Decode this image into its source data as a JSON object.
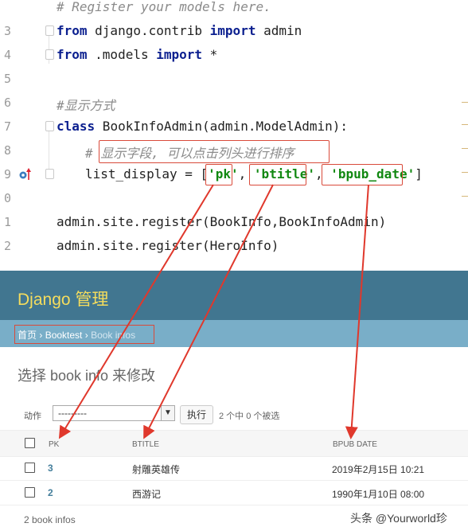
{
  "editor": {
    "lines": [
      {
        "num": "",
        "text": "# Register your models here."
      },
      {
        "num": "3",
        "text": ""
      },
      {
        "num": "4",
        "text": ""
      },
      {
        "num": "5",
        "text": ""
      },
      {
        "num": "6",
        "text": "#显示方式"
      },
      {
        "num": "7",
        "text": ""
      },
      {
        "num": "8",
        "text": "# 显示字段, 可以点击列头进行排序"
      },
      {
        "num": "9",
        "text": ""
      },
      {
        "num": "0",
        "text": ""
      },
      {
        "num": "1",
        "text": "admin.site.register(BookInfo,BookInfoAdmin)"
      },
      {
        "num": "2",
        "text": "admin.site.register(HeroInfo)"
      }
    ],
    "line3": {
      "kw1": "from",
      "mid": " django.contrib ",
      "kw2": "import",
      "tail": " admin"
    },
    "line4": {
      "kw1": "from",
      "mid": " .models ",
      "kw2": "import",
      "tail": " *"
    },
    "line7": {
      "kw": "class",
      "tail": " BookInfoAdmin(admin.ModelAdmin):"
    },
    "line9": {
      "pre": "list_display = [",
      "s1": "'pk'",
      "c1": ", ",
      "s2": "'btitle'",
      "c2": ", ",
      "s3": "'bpub_date'",
      "post": "]"
    }
  },
  "admin": {
    "site_title": "Django 管理",
    "breadcrumbs": {
      "home": "首页",
      "sep": " › ",
      "app": "Booktest",
      "current": "Book infos"
    },
    "heading": "选择 book info 来修改",
    "actions": {
      "label": "动作",
      "selected": "---------",
      "go": "执行",
      "count": "2 个中 0 个被选"
    },
    "columns": [
      "PK",
      "BTITLE",
      "BPUB DATE"
    ],
    "rows": [
      {
        "pk": "3",
        "btitle": "射雕英雄传",
        "bpub_date": "2019年2月15日 10:21"
      },
      {
        "pk": "2",
        "btitle": "西游记",
        "bpub_date": "1990年1月10日 08:00"
      }
    ],
    "result_count": "2 book infos"
  },
  "watermark": "头条 @Yourworld珍",
  "colors": {
    "header": "#417690",
    "breadcrumbs": "#79aec8",
    "title": "#f5dd5d",
    "annotation": "#d94a3a"
  }
}
